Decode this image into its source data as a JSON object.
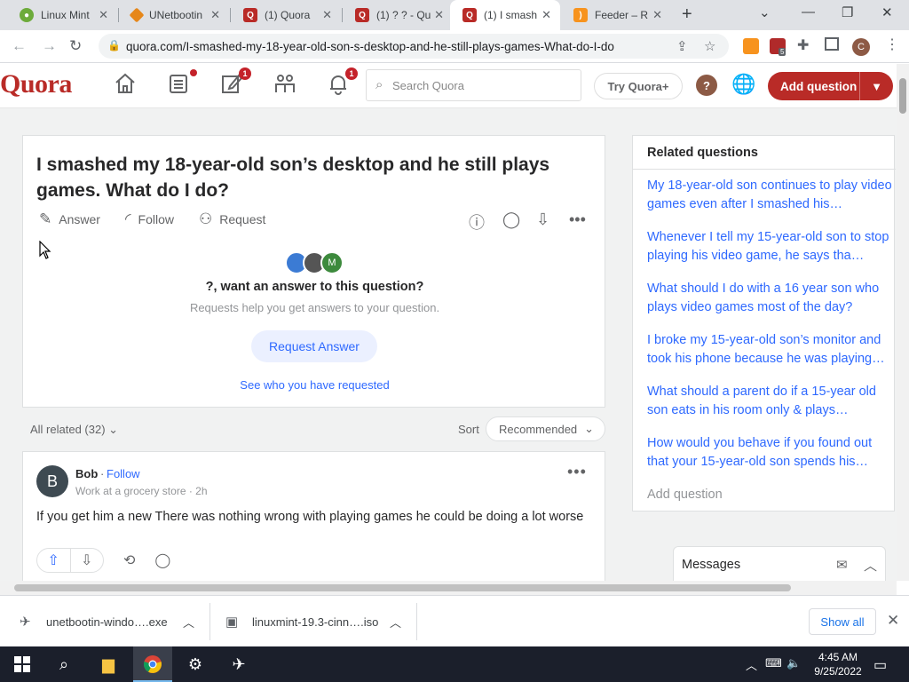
{
  "browser": {
    "tabs": [
      {
        "title": "Linux Mint",
        "favicon_color": "#6dab3b"
      },
      {
        "title": "UNetbootin",
        "favicon_color": "#e6871a"
      },
      {
        "title": "(1) Quora",
        "favicon_color": "#b92b27"
      },
      {
        "title": "(1) ? ? - Qu",
        "favicon_color": "#b92b27"
      },
      {
        "title": "(1) I smash",
        "favicon_color": "#b92b27"
      },
      {
        "title": "Feeder – R",
        "favicon_color": "#f7931e"
      }
    ],
    "active_tab": 4,
    "url": "quora.com/I-smashed-my-18-year-old-son-s-desktop-and-he-still-plays-games-What-do-I-do",
    "extension_badge": "5",
    "profile_initial": "C"
  },
  "quora": {
    "logo": "Quora",
    "following_badge": "1",
    "notifications_badge": "1",
    "search_placeholder": "Search Quora",
    "try_plus": "Try Quora+",
    "help": "?",
    "add_question": "Add question"
  },
  "question": {
    "title": "I smashed my 18-year-old son’s desktop and he still plays games. What do I do?",
    "actions": {
      "answer": "Answer",
      "follow": "Follow",
      "request": "Request"
    },
    "avatar_letter": "M",
    "want_answer": "?, want an answer to this question?",
    "request_help": "Requests help you get answers to your question.",
    "request_button": "Request Answer",
    "see_requested": "See who you have requested"
  },
  "answers_header": {
    "all_related": "All related (32)",
    "sort_label": "Sort",
    "sort_value": "Recommended"
  },
  "answer": {
    "avatar_letter": "B",
    "author": "Bob",
    "separator": "·",
    "follow": "Follow",
    "credential": "Work at a grocery store · 2h",
    "text": "If you get him a new There was nothing wrong with playing games he could be doing a lot worse"
  },
  "related": {
    "title": "Related questions",
    "items": [
      "My 18-year-old son continues to play video games even after I smashed his…",
      "Whenever I tell my 15-year-old son to stop playing his video game, he says tha…",
      "What should I do with a 16 year son who plays video games most of the day?",
      "I broke my 15-year-old son’s monitor and took his phone because he was playing…",
      "What should a parent do if a 15-year old son eats in his room only & plays…",
      "How would you behave if you found out that your 15-year-old son spends his…"
    ],
    "add_question": "Add question"
  },
  "messages": {
    "title": "Messages"
  },
  "downloads": {
    "items": [
      "unetbootin-windo….exe",
      "linuxmint-19.3-cinn….iso"
    ],
    "show_all": "Show all"
  },
  "taskbar": {
    "time": "4:45 AM",
    "date": "9/25/2022"
  },
  "colors": {
    "quora_red": "#b92b27",
    "link_blue": "#2e69ff",
    "taskbar": "#1b1f2b"
  }
}
